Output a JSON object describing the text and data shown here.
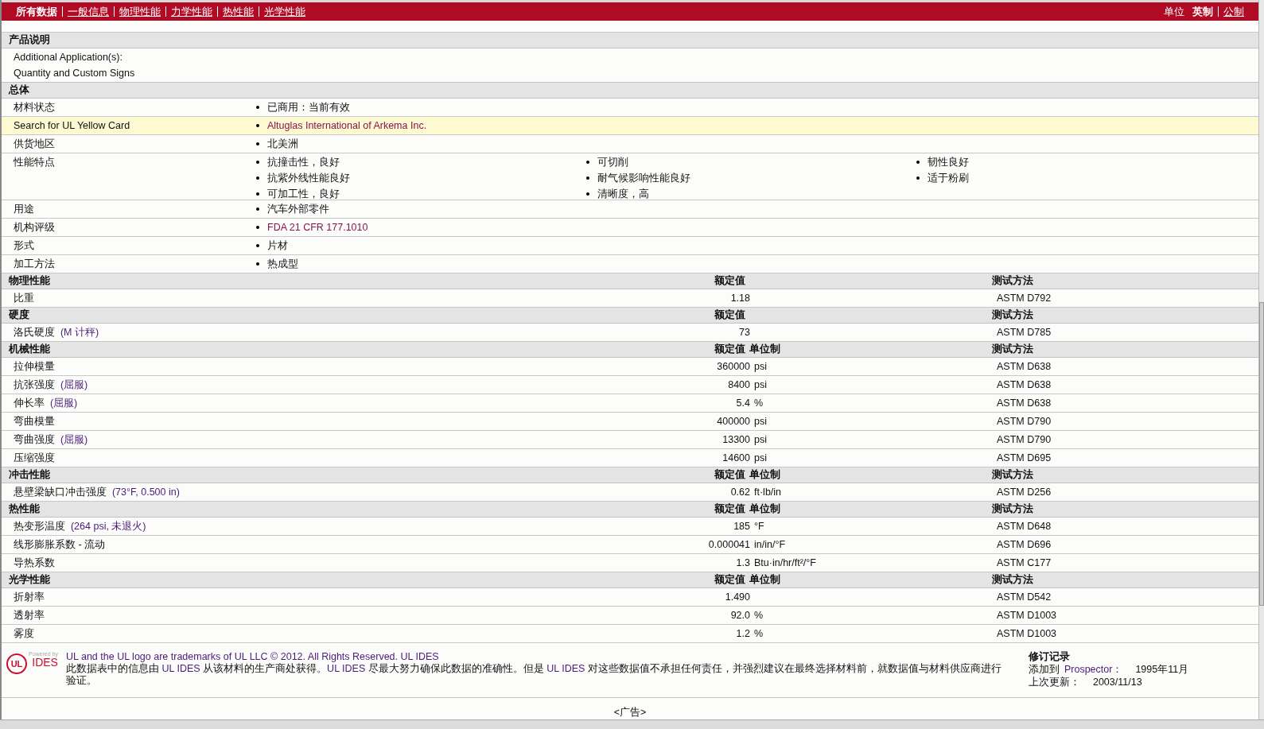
{
  "nav": {
    "items": [
      {
        "label": "所有数据",
        "selected": true
      },
      {
        "label": "一般信息",
        "selected": false
      },
      {
        "label": "物理性能",
        "selected": false
      },
      {
        "label": "力学性能",
        "selected": false
      },
      {
        "label": "热性能",
        "selected": false
      },
      {
        "label": "光学性能",
        "selected": false
      }
    ],
    "units_label": "单位",
    "units": [
      {
        "label": "英制",
        "selected": true
      },
      {
        "label": "公制",
        "selected": false
      }
    ]
  },
  "description": {
    "title": "产品说明",
    "lines": [
      "Additional Application(s):",
      "Quantity and Custom Signs"
    ]
  },
  "general": {
    "title": "总体",
    "rows": [
      {
        "label": "材料状态",
        "highlighted": false,
        "values": [
          {
            "text": "已商用：当前有效",
            "link": false
          }
        ]
      },
      {
        "label": "Search for UL Yellow Card",
        "highlighted": true,
        "values": [
          {
            "text": "Altuglas International of Arkema Inc.",
            "link": true
          }
        ]
      },
      {
        "label": "供货地区",
        "highlighted": false,
        "values": [
          {
            "text": "北美洲",
            "link": false
          }
        ]
      },
      {
        "label": "性能特点",
        "highlighted": false,
        "values": [
          {
            "text": "抗撞击性，良好",
            "link": false
          },
          {
            "text": "可切削",
            "link": false
          },
          {
            "text": "韧性良好",
            "link": false
          },
          {
            "text": "抗紫外线性能良好",
            "link": false
          },
          {
            "text": "耐气候影响性能良好",
            "link": false
          },
          {
            "text": "适于粉刷",
            "link": false
          },
          {
            "text": "可加工性，良好",
            "link": false
          },
          {
            "text": "清晰度，高",
            "link": false
          }
        ]
      },
      {
        "label": "用途",
        "highlighted": false,
        "values": [
          {
            "text": "汽车外部零件",
            "link": false
          }
        ]
      },
      {
        "label": "机构评级",
        "highlighted": false,
        "values": [
          {
            "text": "FDA 21 CFR 177.1010",
            "link": true
          }
        ]
      },
      {
        "label": "形式",
        "highlighted": false,
        "values": [
          {
            "text": "片材",
            "link": false
          }
        ]
      },
      {
        "label": "加工方法",
        "highlighted": false,
        "values": [
          {
            "text": "热成型",
            "link": false
          }
        ]
      }
    ]
  },
  "property_sections": [
    {
      "title": "物理性能",
      "value_header": "额定值",
      "method_header": "测试方法",
      "rows": [
        {
          "name": "比重",
          "value": "1.18",
          "method": "ASTM D792"
        }
      ]
    },
    {
      "title": "硬度",
      "value_header": "额定值",
      "method_header": "测试方法",
      "rows": [
        {
          "name": "洛氏硬度",
          "condition": "(M 计秤)",
          "value": "73",
          "method": "ASTM D785"
        }
      ]
    },
    {
      "title": "机械性能",
      "value_header": "额定值",
      "unit_header": "单位制",
      "method_header": "测试方法",
      "rows": [
        {
          "name": "拉伸模量",
          "value": "360000",
          "unit": "psi",
          "method": "ASTM D638"
        },
        {
          "name": "抗张强度",
          "condition": "(屈服)",
          "value": "8400",
          "unit": "psi",
          "method": "ASTM D638"
        },
        {
          "name": "伸长率",
          "condition": "(屈服)",
          "value": "5.4",
          "unit": "%",
          "method": "ASTM D638"
        },
        {
          "name": "弯曲模量",
          "value": "400000",
          "unit": "psi",
          "method": "ASTM D790"
        },
        {
          "name": "弯曲强度",
          "condition": "(屈服)",
          "value": "13300",
          "unit": "psi",
          "method": "ASTM D790"
        },
        {
          "name": "压缩强度",
          "value": "14600",
          "unit": "psi",
          "method": "ASTM D695"
        }
      ]
    },
    {
      "title": "冲击性能",
      "value_header": "额定值",
      "unit_header": "单位制",
      "method_header": "测试方法",
      "rows": [
        {
          "name": "悬壁梁缺口冲击强度",
          "condition": "(73°F, 0.500 in)",
          "value": "0.62",
          "unit": "ft·lb/in",
          "method": "ASTM D256"
        }
      ]
    },
    {
      "title": "热性能",
      "value_header": "额定值",
      "unit_header": "单位制",
      "method_header": "测试方法",
      "rows": [
        {
          "name": "热变形温度",
          "condition": "(264 psi, 未退火)",
          "value": "185",
          "unit": "°F",
          "method": "ASTM D648"
        },
        {
          "name": "线形膨胀系数  - 流动",
          "value": "0.000041",
          "unit": "in/in/°F",
          "method": "ASTM D696"
        },
        {
          "name": "导热系数",
          "value": "1.3",
          "unit": "Btu·in/hr/ft²/°F",
          "method": "ASTM C177"
        }
      ]
    },
    {
      "title": "光学性能",
      "value_header": "额定值",
      "unit_header": "单位制",
      "method_header": "测试方法",
      "rows": [
        {
          "name": "折射率",
          "value": "1.490",
          "method": "ASTM D542"
        },
        {
          "name": "透射率",
          "value": "92.0",
          "unit": "%",
          "method": "ASTM D1003"
        },
        {
          "name": "雾度",
          "value": "1.2",
          "unit": "%",
          "method": "ASTM D1003"
        }
      ]
    }
  ],
  "footer": {
    "logo": {
      "mark": "UL",
      "tagline": "Powered by",
      "brand": "IDES"
    },
    "legal": "UL and the UL logo are trademarks of UL LLC © 2012. All Rights Reserved. UL IDES",
    "disclaimer": [
      {
        "text": "此数据表中的信息由 ",
        "kind": "plain"
      },
      {
        "text": "UL IDES",
        "kind": "brand"
      },
      {
        "text": " 从该材料的生产商处获得。",
        "kind": "plain"
      },
      {
        "text": "UL IDES",
        "kind": "brand"
      },
      {
        "text": " 尽最大努力确保此数据的准确性。但是 ",
        "kind": "plain"
      },
      {
        "text": "UL IDES",
        "kind": "brand"
      },
      {
        "text": " 对这些数据值不承担任何责任，并强烈建议在最终选择材料前，就数据值与材料供应商进行验证。",
        "kind": "plain"
      }
    ],
    "revision": {
      "title": "修订记录",
      "entries": [
        {
          "label": "添加到",
          "link": "Prospector：",
          "value": "1995年11月"
        },
        {
          "label": "上次更新：",
          "value": "2003/11/13"
        }
      ]
    }
  },
  "ad": "<广告>"
}
